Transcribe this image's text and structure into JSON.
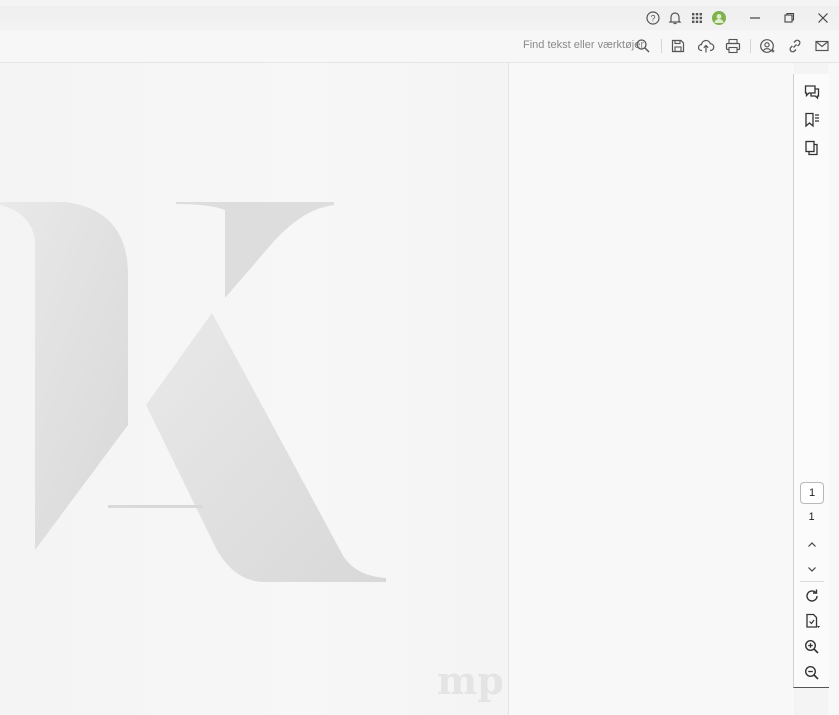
{
  "titlebar": {
    "icons": [
      "help-icon",
      "bell-icon",
      "apps-grid-icon",
      "account-avatar-icon",
      "minimize-icon",
      "restore-icon",
      "close-icon"
    ]
  },
  "toolbar": {
    "search_placeholder": "Find tekst eller værktøjer",
    "icons": [
      "search-icon",
      "save-icon",
      "cloud-upload-icon",
      "print-icon",
      "share-user-icon",
      "link-icon",
      "mail-icon"
    ]
  },
  "document": {
    "logo_letter": "K",
    "watermark": "mp"
  },
  "rightbar": {
    "icons": [
      "comments-icon",
      "bookmarks-icon",
      "pages-copy-icon"
    ],
    "current_page": "1",
    "total_pages": "1",
    "nav_icons": [
      "chevron-up-icon",
      "chevron-down-icon",
      "refresh-icon",
      "document-export-icon",
      "zoom-in-icon",
      "zoom-out-icon"
    ]
  },
  "colors": {
    "accent_avatar": "#7fb24c",
    "icon": "#444444"
  }
}
